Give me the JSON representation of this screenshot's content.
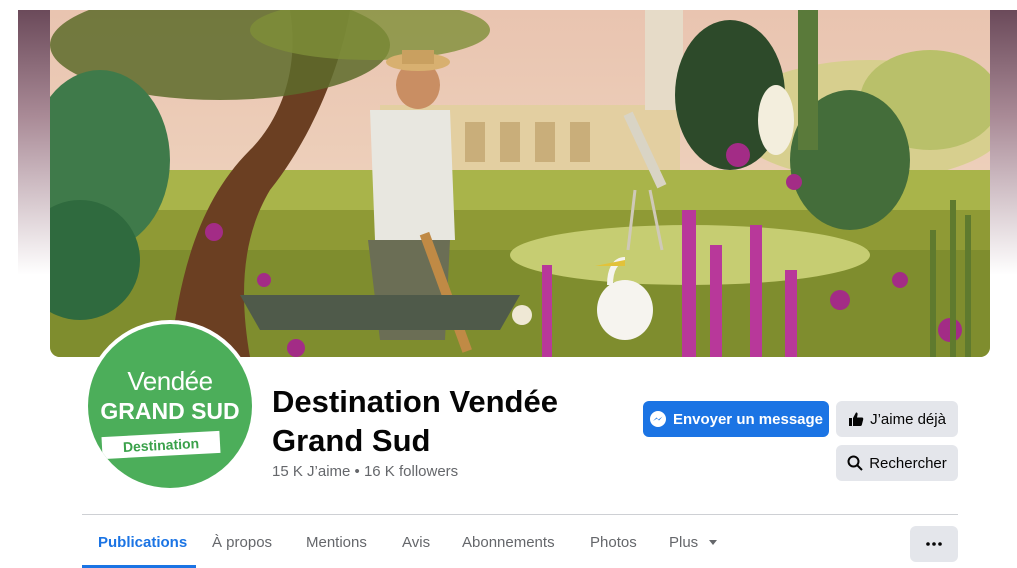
{
  "page": {
    "name": "Destination Vendée Grand Sud",
    "stats": "15 K J’aime • 16 K followers"
  },
  "logo": {
    "line1": "Vendée",
    "line2": "GRAND SUD",
    "tag": "Destination",
    "color": "#4cae5a"
  },
  "actions": {
    "message_label": "Envoyer un message",
    "like_label": "J’aime déjà",
    "search_label": "Rechercher",
    "more_icon": "more-dots-icon"
  },
  "tabs": [
    {
      "label": "Publications",
      "active": true
    },
    {
      "label": "À propos",
      "active": false
    },
    {
      "label": "Mentions",
      "active": false
    },
    {
      "label": "Avis",
      "active": false
    },
    {
      "label": "Abonnements",
      "active": false
    },
    {
      "label": "Photos",
      "active": false
    },
    {
      "label": "Plus",
      "active": false
    }
  ],
  "colors": {
    "accent": "#1b74e4",
    "secondary_button": "#e4e6eb",
    "muted_text": "#65676b"
  }
}
